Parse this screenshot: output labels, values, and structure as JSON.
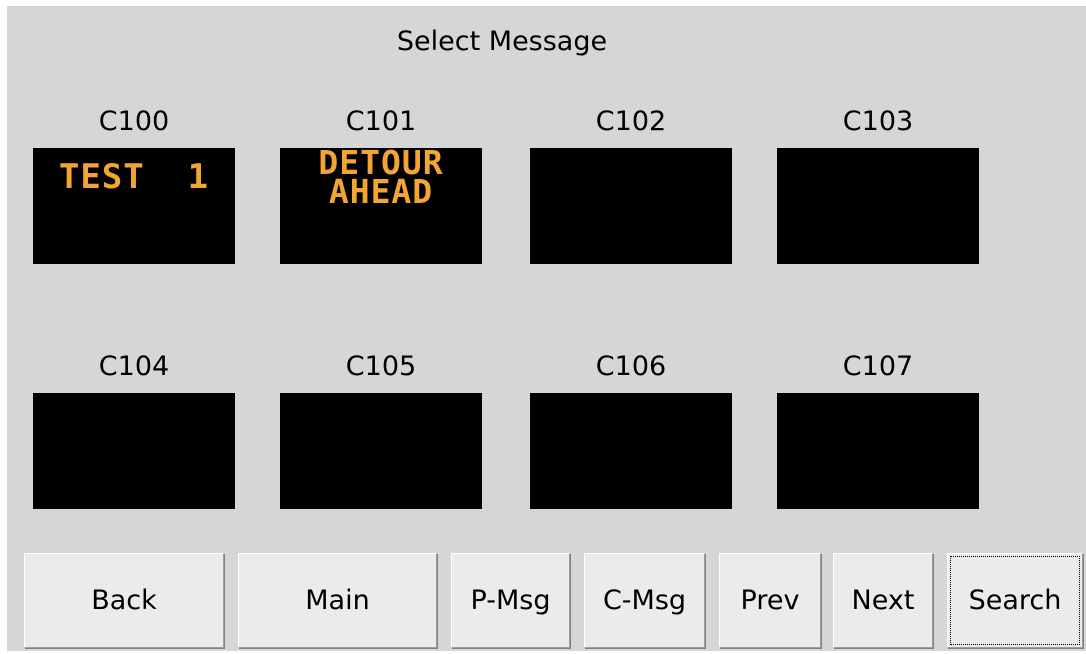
{
  "title": "Select Message",
  "messages": [
    {
      "id": "C100",
      "text": "TEST  1"
    },
    {
      "id": "C101",
      "text": "DETOUR\nAHEAD"
    },
    {
      "id": "C102",
      "text": ""
    },
    {
      "id": "C103",
      "text": ""
    },
    {
      "id": "C104",
      "text": ""
    },
    {
      "id": "C105",
      "text": ""
    },
    {
      "id": "C106",
      "text": ""
    },
    {
      "id": "C107",
      "text": ""
    }
  ],
  "buttons": {
    "back": "Back",
    "main": "Main",
    "p_msg": "P-Msg",
    "c_msg": "C-Msg",
    "prev": "Prev",
    "next": "Next",
    "search": "Search"
  },
  "colors": {
    "background": "#d6d6d6",
    "sign_background": "#000000",
    "sign_text": "#f3a531",
    "button": "#ebebeb"
  }
}
